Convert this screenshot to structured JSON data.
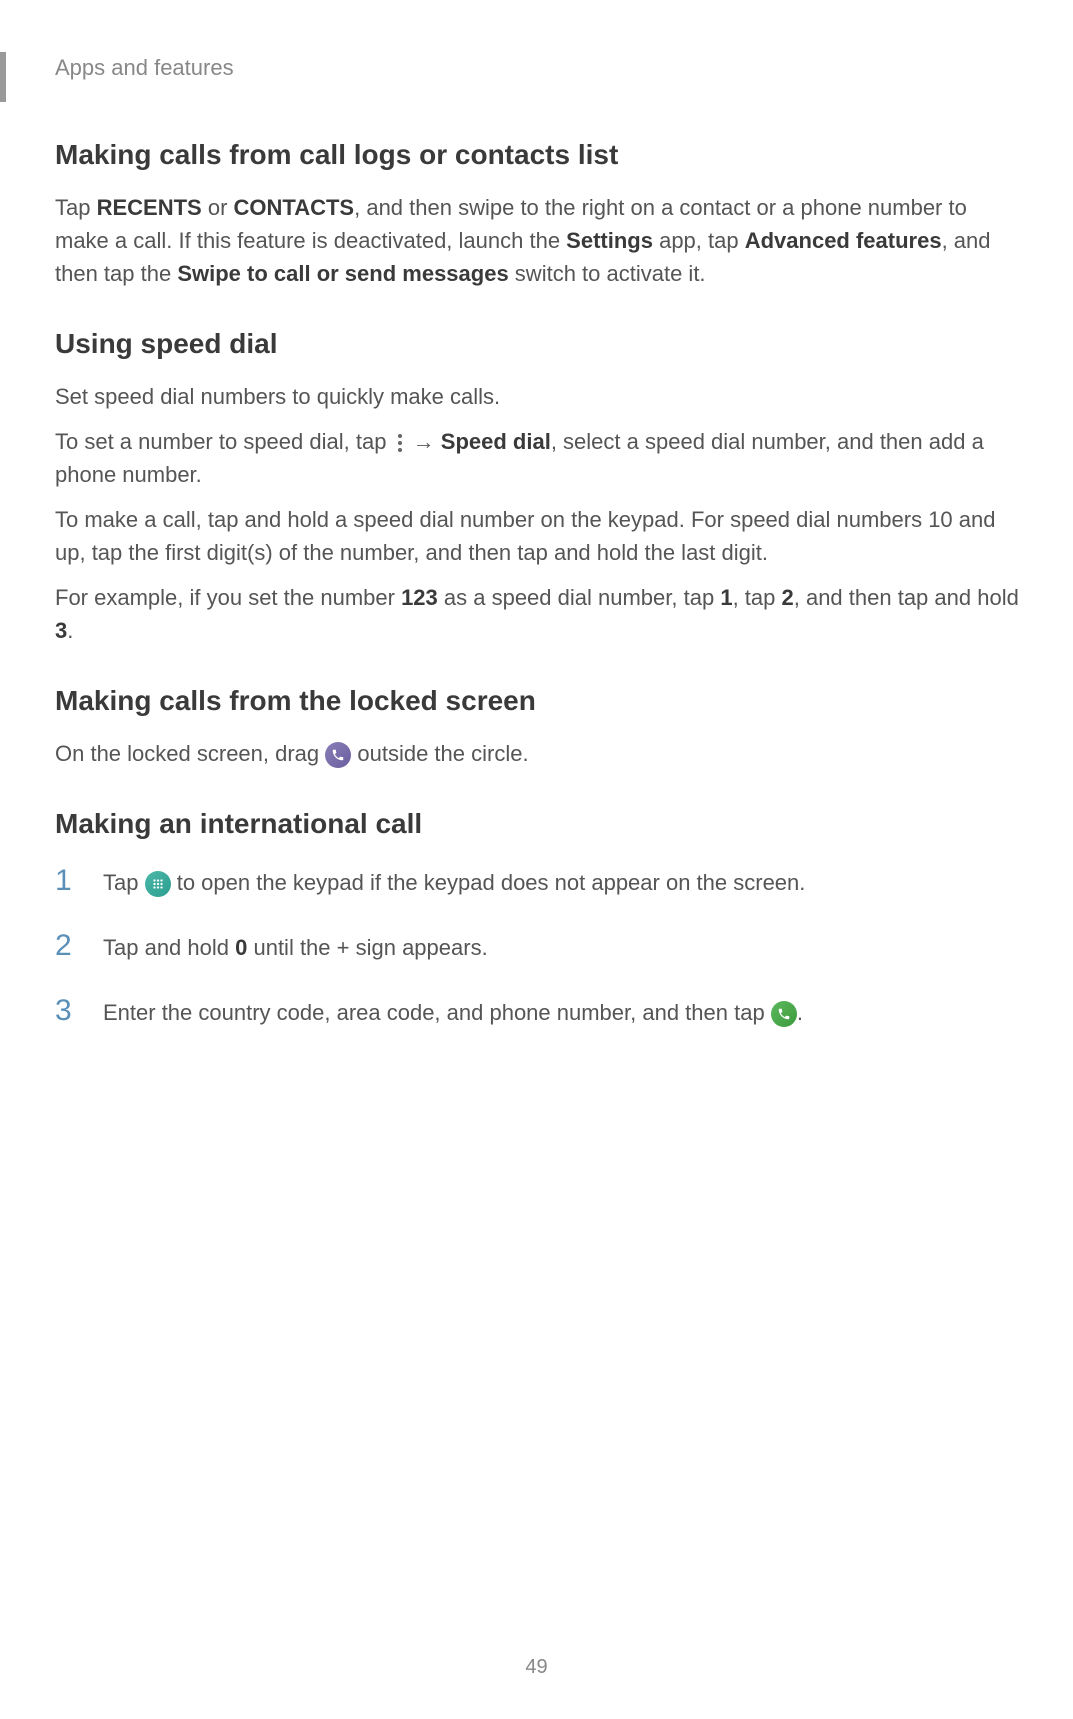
{
  "breadcrumb": "Apps and features",
  "page_number": "49",
  "sections": {
    "call_logs": {
      "heading": "Making calls from call logs or contacts list",
      "text_part1": "Tap ",
      "bold_recents": "RECENTS",
      "text_part2": " or ",
      "bold_contacts": "CONTACTS",
      "text_part3": ", and then swipe to the right on a contact or a phone number to make a call. If this feature is deactivated, launch the ",
      "bold_settings": "Settings",
      "text_part4": " app, tap ",
      "bold_advanced": "Advanced features",
      "text_part5": ", and then tap the ",
      "bold_swipe": "Swipe to call or send messages",
      "text_part6": " switch to activate it."
    },
    "speed_dial": {
      "heading": "Using speed dial",
      "para1": "Set speed dial numbers to quickly make calls.",
      "para2_part1": "To set a number to speed dial, tap ",
      "para2_arrow": " → ",
      "para2_bold": "Speed dial",
      "para2_part2": ", select a speed dial number, and then add a phone number.",
      "para3": "To make a call, tap and hold a speed dial number on the keypad. For speed dial numbers 10 and up, tap the first digit(s) of the number, and then tap and hold the last digit.",
      "para4_part1": "For example, if you set the number ",
      "para4_bold1": "123",
      "para4_part2": " as a speed dial number, tap ",
      "para4_bold2": "1",
      "para4_part3": ", tap ",
      "para4_bold3": "2",
      "para4_part4": ", and then tap and hold ",
      "para4_bold4": "3",
      "para4_part5": "."
    },
    "locked_screen": {
      "heading": "Making calls from the locked screen",
      "text_part1": "On the locked screen, drag ",
      "text_part2": " outside the circle."
    },
    "international": {
      "heading": "Making an international call",
      "step1_part1": "Tap ",
      "step1_part2": " to open the keypad if the keypad does not appear on the screen.",
      "step2_part1": "Tap and hold ",
      "step2_bold": "0",
      "step2_part2": " until the + sign appears.",
      "step3_part1": "Enter the country code, area code, and phone number, and then tap ",
      "step3_part2": "."
    }
  }
}
